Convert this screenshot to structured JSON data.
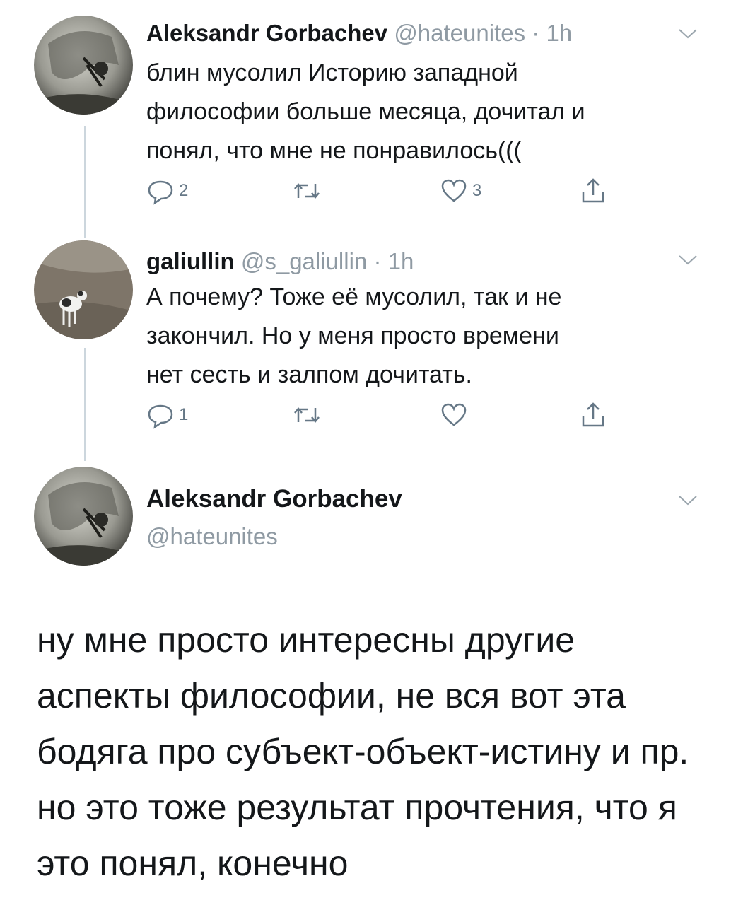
{
  "colors": {
    "text": "#14171a",
    "secondary": "#8f9aa3",
    "thread_line": "#ccd6dd",
    "icon": "#657786"
  },
  "tweets": [
    {
      "author": "Aleksandr Gorbachev",
      "handle": "@hateunites",
      "separator": "·",
      "time": "1h",
      "text": "блин мусолил Историю западной\nфилософии больше месяца, дочитал и\nпонял, что мне не понравилось(((",
      "reply_count": "2",
      "like_count": "3",
      "avatar_icon": "statue-photo-avatar",
      "icons": [
        "reply-icon",
        "retweet-icon",
        "like-icon",
        "share-icon",
        "chevron-down-icon"
      ]
    },
    {
      "author": "galiullin",
      "handle": "@s_galiullin",
      "separator": "·",
      "time": "1h",
      "text": "А почему? Тоже её мусолил, так и не\nзакончил. Но у меня просто времени\nнет сесть и залпом дочитать.",
      "reply_count": "1",
      "like_count": "",
      "avatar_icon": "cat-photo-avatar",
      "icons": [
        "reply-icon",
        "retweet-icon",
        "like-icon",
        "share-icon",
        "chevron-down-icon"
      ]
    }
  ],
  "main_tweet": {
    "author": "Aleksandr Gorbachev",
    "handle": "@hateunites",
    "text": "ну мне просто интересны другие аспекты философии, не вся вот эта бодяга про субъект-объект-истину и пр. но это тоже результат прочтения, что я это понял, конечно",
    "avatar_icon": "statue-photo-avatar"
  }
}
